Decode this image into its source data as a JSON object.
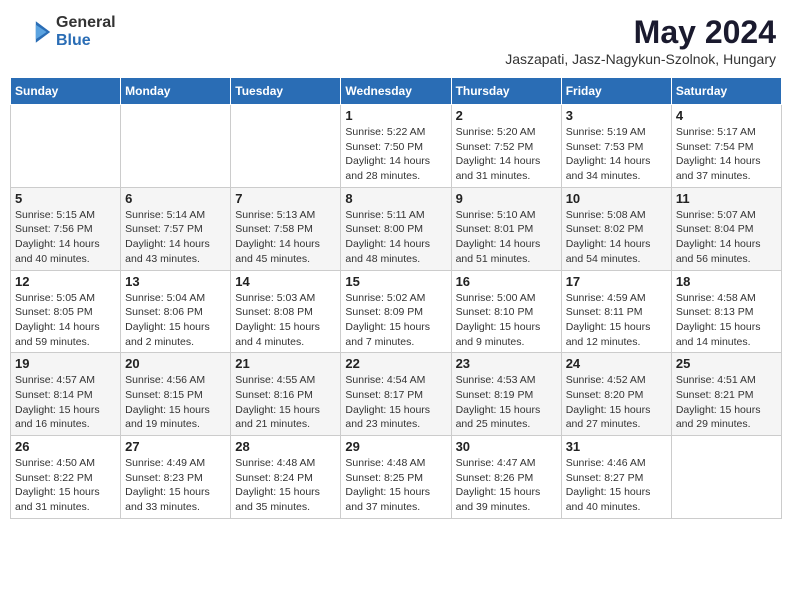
{
  "header": {
    "logo_general": "General",
    "logo_blue": "Blue",
    "month_year": "May 2024",
    "location": "Jaszapati, Jasz-Nagykun-Szolnok, Hungary"
  },
  "weekdays": [
    "Sunday",
    "Monday",
    "Tuesday",
    "Wednesday",
    "Thursday",
    "Friday",
    "Saturday"
  ],
  "weeks": [
    [
      null,
      null,
      null,
      {
        "day": 1,
        "sunrise": "5:22 AM",
        "sunset": "7:50 PM",
        "daylight": "14 hours and 28 minutes."
      },
      {
        "day": 2,
        "sunrise": "5:20 AM",
        "sunset": "7:52 PM",
        "daylight": "14 hours and 31 minutes."
      },
      {
        "day": 3,
        "sunrise": "5:19 AM",
        "sunset": "7:53 PM",
        "daylight": "14 hours and 34 minutes."
      },
      {
        "day": 4,
        "sunrise": "5:17 AM",
        "sunset": "7:54 PM",
        "daylight": "14 hours and 37 minutes."
      }
    ],
    [
      {
        "day": 5,
        "sunrise": "5:15 AM",
        "sunset": "7:56 PM",
        "daylight": "14 hours and 40 minutes."
      },
      {
        "day": 6,
        "sunrise": "5:14 AM",
        "sunset": "7:57 PM",
        "daylight": "14 hours and 43 minutes."
      },
      {
        "day": 7,
        "sunrise": "5:13 AM",
        "sunset": "7:58 PM",
        "daylight": "14 hours and 45 minutes."
      },
      {
        "day": 8,
        "sunrise": "5:11 AM",
        "sunset": "8:00 PM",
        "daylight": "14 hours and 48 minutes."
      },
      {
        "day": 9,
        "sunrise": "5:10 AM",
        "sunset": "8:01 PM",
        "daylight": "14 hours and 51 minutes."
      },
      {
        "day": 10,
        "sunrise": "5:08 AM",
        "sunset": "8:02 PM",
        "daylight": "14 hours and 54 minutes."
      },
      {
        "day": 11,
        "sunrise": "5:07 AM",
        "sunset": "8:04 PM",
        "daylight": "14 hours and 56 minutes."
      }
    ],
    [
      {
        "day": 12,
        "sunrise": "5:05 AM",
        "sunset": "8:05 PM",
        "daylight": "14 hours and 59 minutes."
      },
      {
        "day": 13,
        "sunrise": "5:04 AM",
        "sunset": "8:06 PM",
        "daylight": "15 hours and 2 minutes."
      },
      {
        "day": 14,
        "sunrise": "5:03 AM",
        "sunset": "8:08 PM",
        "daylight": "15 hours and 4 minutes."
      },
      {
        "day": 15,
        "sunrise": "5:02 AM",
        "sunset": "8:09 PM",
        "daylight": "15 hours and 7 minutes."
      },
      {
        "day": 16,
        "sunrise": "5:00 AM",
        "sunset": "8:10 PM",
        "daylight": "15 hours and 9 minutes."
      },
      {
        "day": 17,
        "sunrise": "4:59 AM",
        "sunset": "8:11 PM",
        "daylight": "15 hours and 12 minutes."
      },
      {
        "day": 18,
        "sunrise": "4:58 AM",
        "sunset": "8:13 PM",
        "daylight": "15 hours and 14 minutes."
      }
    ],
    [
      {
        "day": 19,
        "sunrise": "4:57 AM",
        "sunset": "8:14 PM",
        "daylight": "15 hours and 16 minutes."
      },
      {
        "day": 20,
        "sunrise": "4:56 AM",
        "sunset": "8:15 PM",
        "daylight": "15 hours and 19 minutes."
      },
      {
        "day": 21,
        "sunrise": "4:55 AM",
        "sunset": "8:16 PM",
        "daylight": "15 hours and 21 minutes."
      },
      {
        "day": 22,
        "sunrise": "4:54 AM",
        "sunset": "8:17 PM",
        "daylight": "15 hours and 23 minutes."
      },
      {
        "day": 23,
        "sunrise": "4:53 AM",
        "sunset": "8:19 PM",
        "daylight": "15 hours and 25 minutes."
      },
      {
        "day": 24,
        "sunrise": "4:52 AM",
        "sunset": "8:20 PM",
        "daylight": "15 hours and 27 minutes."
      },
      {
        "day": 25,
        "sunrise": "4:51 AM",
        "sunset": "8:21 PM",
        "daylight": "15 hours and 29 minutes."
      }
    ],
    [
      {
        "day": 26,
        "sunrise": "4:50 AM",
        "sunset": "8:22 PM",
        "daylight": "15 hours and 31 minutes."
      },
      {
        "day": 27,
        "sunrise": "4:49 AM",
        "sunset": "8:23 PM",
        "daylight": "15 hours and 33 minutes."
      },
      {
        "day": 28,
        "sunrise": "4:48 AM",
        "sunset": "8:24 PM",
        "daylight": "15 hours and 35 minutes."
      },
      {
        "day": 29,
        "sunrise": "4:48 AM",
        "sunset": "8:25 PM",
        "daylight": "15 hours and 37 minutes."
      },
      {
        "day": 30,
        "sunrise": "4:47 AM",
        "sunset": "8:26 PM",
        "daylight": "15 hours and 39 minutes."
      },
      {
        "day": 31,
        "sunrise": "4:46 AM",
        "sunset": "8:27 PM",
        "daylight": "15 hours and 40 minutes."
      },
      null
    ]
  ]
}
